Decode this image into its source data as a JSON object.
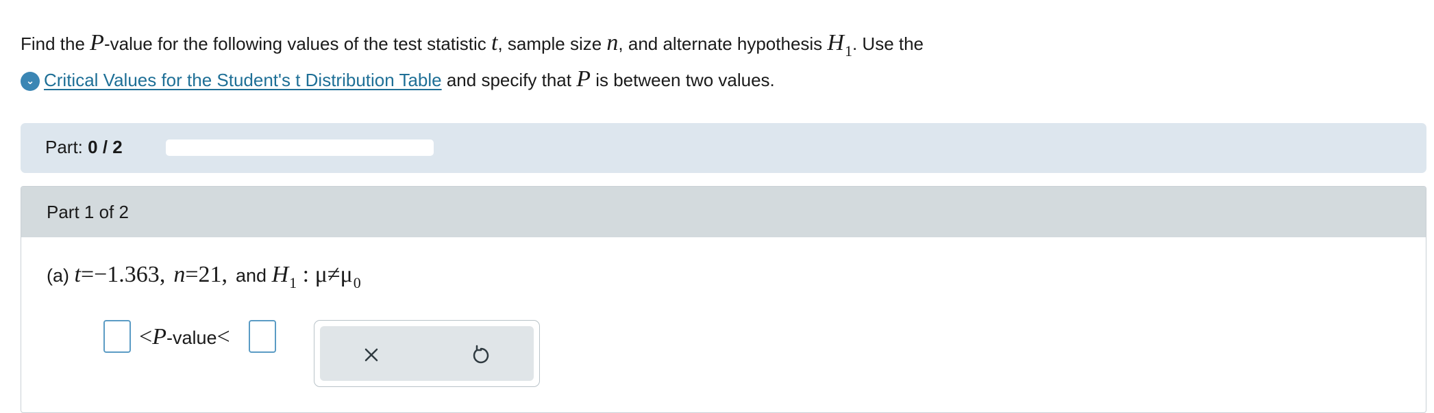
{
  "instructions": {
    "line1_a": "Find the ",
    "p_symbol": "P",
    "line1_b": "-value for the following values of the test statistic ",
    "t_symbol": "t",
    "line1_c": ", sample size ",
    "n_symbol": "n",
    "line1_d": ", and alternate hypothesis ",
    "h_symbol": "H",
    "h_sub": "1",
    "line1_e": ". Use the",
    "table_link": "Critical Values for the Student's t Distribution Table",
    "line2_a": " and specify that ",
    "line2_p": "P",
    "line2_b": " is between two values."
  },
  "progress": {
    "label": "Part: ",
    "value_text": "0 / 2",
    "fraction": 0.0
  },
  "part": {
    "header": "Part 1 of 2",
    "question": {
      "prefix": "(a) ",
      "t_var": "t",
      "t_eq": "=−1.363",
      "comma1": ",",
      "n_var": "n",
      "n_eq": "=21",
      "comma2": ",",
      "and": "and ",
      "h_var": "H",
      "h_sub": "1",
      "h_rel": " : μ≠μ",
      "h_rel_sub": "0"
    },
    "answer": {
      "lt1": "<",
      "p_var": "P",
      "label": "-value",
      "lt2": "<",
      "lower_value": "",
      "upper_value": ""
    }
  },
  "tools": {
    "clear_icon": "x-icon",
    "undo_icon": "undo-icon"
  },
  "colors": {
    "accent": "#3b86b4",
    "link": "#1e6f96",
    "progress_bg": "#dde6ee",
    "part_header_bg": "#d3dadd"
  }
}
